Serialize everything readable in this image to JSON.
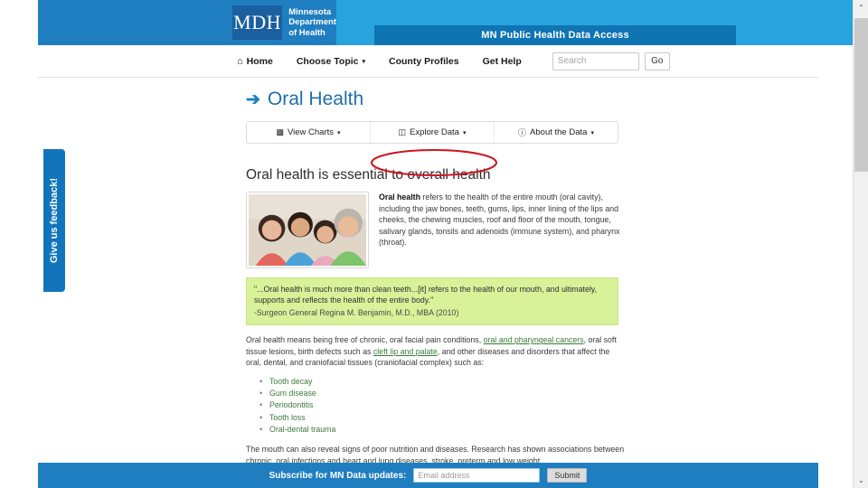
{
  "header": {
    "logo_mark": "MDH",
    "logo_line1": "Minnesota",
    "logo_line2": "Department",
    "logo_line3": "of Health",
    "banner_title": "MN Public Health Data Access",
    "colors": {
      "dark_blue": "#1f7ec0",
      "light_blue": "#28a3dd",
      "strip_blue": "#0f74b4"
    }
  },
  "nav": {
    "home_icon": "home-icon",
    "items": [
      {
        "label": "Home",
        "has_caret": false
      },
      {
        "label": "Choose Topic",
        "has_caret": true
      },
      {
        "label": "County Profiles",
        "has_caret": false
      },
      {
        "label": "Get Help",
        "has_caret": false
      }
    ],
    "search_placeholder": "Search",
    "search_value": "",
    "go_label": "Go"
  },
  "page": {
    "title": "Oral Health",
    "title_arrow": "➔",
    "tabs": [
      {
        "label": "View Charts",
        "icon": "bar-chart-icon",
        "caret": "▾",
        "highlighted": false
      },
      {
        "label": "Explore Data",
        "icon": "database-icon",
        "caret": "▾",
        "highlighted": true
      },
      {
        "label": "About the Data",
        "icon": "info-icon",
        "caret": "▾",
        "highlighted": false
      }
    ],
    "annotation": {
      "type": "red-ellipse",
      "target": "Explore Data",
      "color": "#cc1622"
    },
    "section_heading": "Oral health is essential to overall health",
    "photo_alt": "Family of four smiling",
    "intro_bold": "Oral health",
    "intro_text": " refers to the health of the entire mouth (oral cavity), including the jaw bones, teeth, gums, lips, inner lining of the lips and cheeks, the chewing muscles, roof and floor of the mouth, tongue, salivary glands, tonsils and adenoids (immune system), and pharynx (throat).",
    "quote": "\"...Oral health is much more than clean teeth...[it] refers to the health of our mouth, and ultimately, supports and reflects the health of the entire body.\"",
    "quote_cite": "-Surgeon General Regina M. Benjamin, M.D., MBA (2010)",
    "quote_bg": "#d9f29a",
    "body_part1": "Oral health means being free of chronic, oral facial pain conditions, ",
    "body_link1": "oral and pharyngeal cancers",
    "body_part2": ", oral soft tissue lesions, birth defects such as ",
    "body_link2": "cleft lip and palate",
    "body_part3": ", and other diseases and disorders that affect the oral, dental, and craniofacial tissues (craniofacial complex) such as:",
    "bullets": [
      "Tooth decay",
      "Gum disease",
      "Periodontitis",
      "Tooth loss",
      "Oral-dental trauma"
    ],
    "tail_text": "The mouth can also reveal signs of poor nutrition and diseases. Research has shown associations between chronic, oral infections and heart and lung diseases, stroke, preterm and low weight"
  },
  "feedback_tab": {
    "label": "Give us feedback!"
  },
  "footer": {
    "label": "Subscribe for MN Data updates:",
    "email_placeholder": "Email address",
    "email_value": "",
    "submit_label": "Submit"
  },
  "scrollbar": {
    "up_arrow": "⌃",
    "down_arrow": "⌄"
  }
}
